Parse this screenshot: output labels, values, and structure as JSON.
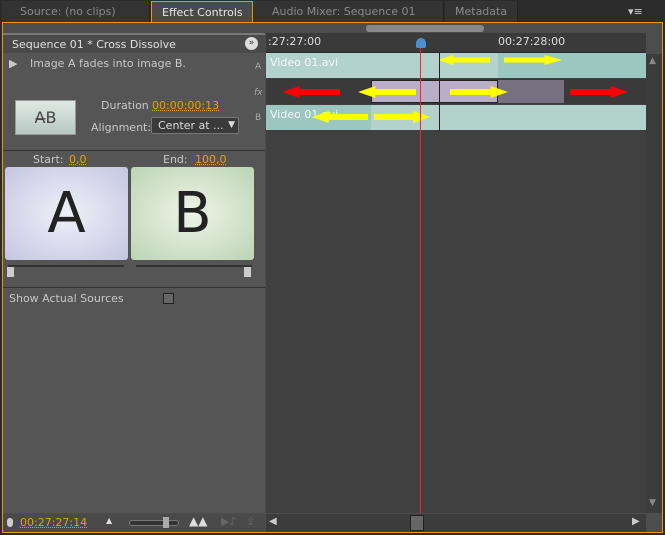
{
  "tabs": [
    {
      "label": "Source: (no clips)"
    },
    {
      "label": "Effect Controls"
    },
    {
      "label": "Audio Mixer: Sequence 01"
    },
    {
      "label": "Metadata"
    }
  ],
  "header": {
    "title": "Sequence 01 * Cross Dissolve"
  },
  "effect": {
    "description": "Image A fades into image B.",
    "duration_label": "Duration",
    "duration": "00:00:00:13",
    "alignment_label": "Alignment:",
    "alignment": "Center at ...",
    "start_label": "Start:",
    "start": "0,0",
    "end_label": "End:",
    "end": "100,0",
    "preview_a": "A",
    "preview_b": "B",
    "show_sources": "Show Actual Sources"
  },
  "timeline": {
    "time_start": ":27:27:00",
    "time_mid": "00:27:28:00",
    "track_a_label": "A",
    "track_fx_label": "fx",
    "track_b_label": "B",
    "clip_a": "Video 01.avi",
    "clip_b": "Video 01.avi"
  },
  "footer": {
    "timecode": "00:27:27:14"
  },
  "colors": {
    "accent": "#e8a000",
    "playhead": "#ff2020",
    "clip": "#b4d2cc",
    "transition": "#b8aec8"
  }
}
